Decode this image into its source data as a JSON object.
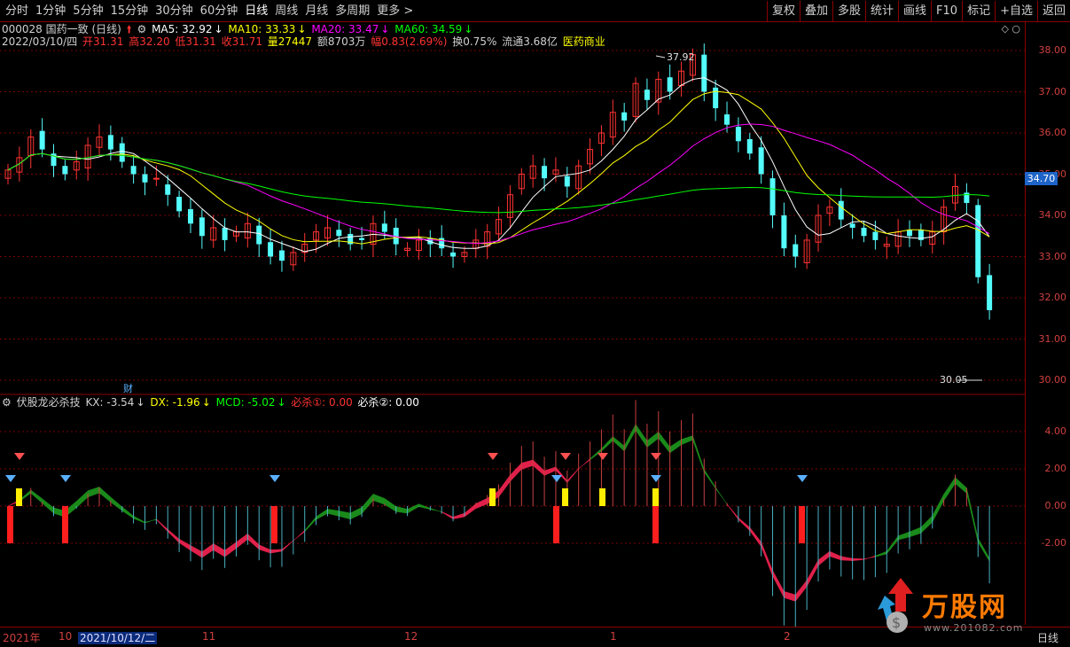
{
  "toolbar": {
    "periods": [
      "分时",
      "1分钟",
      "5分钟",
      "15分钟",
      "30分钟",
      "60分钟",
      "日线",
      "周线",
      "月线",
      "多周期",
      "更多 >"
    ],
    "active_period": "日线",
    "right_buttons": [
      "复权",
      "叠加",
      "多股",
      "统计",
      "画线",
      "F10",
      "标记",
      "+自选",
      "返回"
    ]
  },
  "stock": {
    "header": "000028 国药一致 (日线)",
    "date_line": "2022/03/10/四",
    "open": "开31.31",
    "high": "高32.20",
    "low": "低31.31",
    "close": "收31.71",
    "volume": "量27447",
    "amount": "额8703万",
    "change": "幅0.83(2.69%)",
    "turnover": "换0.75%",
    "float": "流通3.68亿",
    "sector": "医药商业",
    "ma5": "MA5: 32.92",
    "ma10": "MA10: 33.33",
    "ma20": "MA20: 33.47",
    "ma60": "MA60: 34.59",
    "current_price_tag": "34.70",
    "high_note": "37.92",
    "low_note": "30.05",
    "cai_mark": "财",
    "arrow_down": "↓",
    "arrow_up": "↑"
  },
  "indicator": {
    "name": "伏股龙必杀技",
    "kx": "KX: -3.54",
    "dx": "DX: -1.96",
    "mcd": "MCD: -5.02",
    "bisha1": "必杀①: 0.00",
    "bisha2": "必杀②: 0.00"
  },
  "price_axis": [
    "38.00",
    "37.00",
    "36.00",
    "35.00",
    "34.00",
    "33.00",
    "32.00",
    "31.00",
    "30.00"
  ],
  "ind_axis": [
    "4.00",
    "2.00",
    "0.00",
    "-2.00"
  ],
  "date_axis": {
    "year": "2021年",
    "m10": "10",
    "highlight": "2021/10/12/二",
    "m11": "11",
    "m12": "12",
    "m1": "1",
    "m2": "2",
    "right_label": "日线"
  },
  "watermark": {
    "text": "万股网",
    "url": "www.201082.com"
  },
  "colors": {
    "up": "#ff3232",
    "down": "#54fcfc",
    "ma5": "#ffffff",
    "ma10": "#ffff00",
    "ma20": "#ff00ff",
    "ma60": "#00ff00",
    "grid": "#7a0000"
  },
  "chart_data": {
    "type": "candlestick",
    "title": "000028 国药一致 (日线)",
    "last_bar": {
      "date": "2022/03/10",
      "open": 31.31,
      "high": 32.2,
      "low": 31.31,
      "close": 31.71
    },
    "period_high": 37.92,
    "period_low": 30.05,
    "moving_averages": {
      "MA5": 32.92,
      "MA10": 33.33,
      "MA20": 33.47,
      "MA60": 34.59
    },
    "closes": [
      35.1,
      35.4,
      35.9,
      35.6,
      35.2,
      35.0,
      35.3,
      35.7,
      35.9,
      35.6,
      35.3,
      35.0,
      34.8,
      34.9,
      34.5,
      34.1,
      33.8,
      33.5,
      33.7,
      33.4,
      33.6,
      33.8,
      33.3,
      33.0,
      32.9,
      33.1,
      33.3,
      33.6,
      33.7,
      33.5,
      33.3,
      33.4,
      33.8,
      33.6,
      33.3,
      33.2,
      33.4,
      33.3,
      33.2,
      33.0,
      33.1,
      33.4,
      33.6,
      33.9,
      34.5,
      35.0,
      35.2,
      34.9,
      35.1,
      34.7,
      35.2,
      35.6,
      36.0,
      36.5,
      36.3,
      37.2,
      36.8,
      37.3,
      37.0,
      37.5,
      37.9,
      37.0,
      36.6,
      36.2,
      35.8,
      35.5,
      35.0,
      34.0,
      33.2,
      33.0,
      33.4,
      34.0,
      34.2,
      33.9,
      33.7,
      33.5,
      33.4,
      33.3,
      33.6,
      33.5,
      33.4,
      33.6,
      34.2,
      34.7,
      34.3,
      32.5,
      31.7
    ]
  }
}
